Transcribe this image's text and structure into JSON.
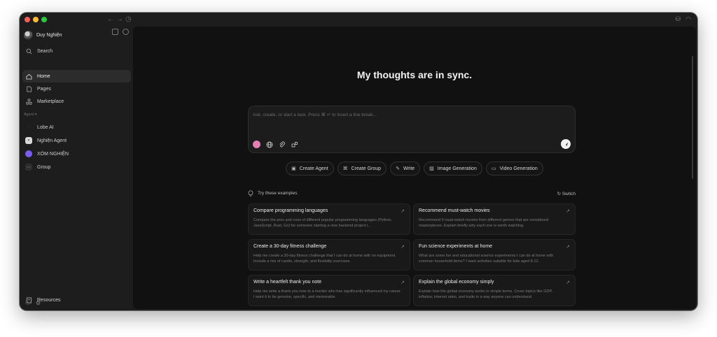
{
  "window": {
    "nav_back": "←",
    "nav_forward": "→",
    "history": "◷"
  },
  "sidebar": {
    "user_name": "Duy Nghiện",
    "nav": [
      {
        "label": "Search",
        "icon": "search-icon"
      },
      {
        "label": "Home",
        "icon": "home-icon"
      },
      {
        "label": "Pages",
        "icon": "page-icon"
      },
      {
        "label": "Marketplace",
        "icon": "marketplace-icon"
      }
    ],
    "section_label": "Agent ▾",
    "agents": [
      {
        "label": "Lobe AI",
        "icon": "lobe-ai-icon"
      },
      {
        "label": "Nghiện Agent",
        "icon": "robot-icon"
      },
      {
        "label": "XÓM NGHIỆN",
        "icon": "xom-nghien-avatar"
      },
      {
        "label": "Group",
        "icon": "group-icon"
      }
    ],
    "resources_label": "Resources"
  },
  "main": {
    "hero_title": "My thoughts are in sync.",
    "chat": {
      "placeholder": "Ask, create, or start a task. Press ⌘ ↵ to insert a line break..."
    },
    "actions": [
      {
        "label": "Create Agent",
        "icon": "agent-icon"
      },
      {
        "label": "Create Group",
        "icon": "group-icon"
      },
      {
        "label": "Write",
        "icon": "pen-icon"
      },
      {
        "label": "Image Generation",
        "icon": "image-icon"
      },
      {
        "label": "Video Generation",
        "icon": "video-icon"
      }
    ],
    "examples": {
      "title": "Try these examples",
      "switch_label": "Switch",
      "cards": [
        {
          "title": "Compare programming languages",
          "desc": "Compare the pros and cons of different popular programming languages (Python, JavaScript, Rust, Go) for someone starting a new backend project i..."
        },
        {
          "title": "Recommend must-watch movies",
          "desc": "Recommend 5 must-watch movies from different genres that are considered masterpieces. Explain briefly why each one is worth watching."
        },
        {
          "title": "Create a 30-day fitness challenge",
          "desc": "Help me create a 30-day fitness challenge that I can do at home with no equipment. Include a mix of cardio, strength, and flexibility exercises."
        },
        {
          "title": "Fun science experiments at home",
          "desc": "What are some fun and educational science experiments I can do at home with common household items? I want activities suitable for kids aged 8-12."
        },
        {
          "title": "Write a heartfelt thank you note",
          "desc": "Help me write a thank you note to a mentor who has significantly influenced my career. I want it to be genuine, specific, and memorable."
        },
        {
          "title": "Explain the global economy simply",
          "desc": "Explain how the global economy works in simple terms. Cover topics like GDP, inflation, interest rates, and trade in a way anyone can understand."
        }
      ]
    }
  }
}
